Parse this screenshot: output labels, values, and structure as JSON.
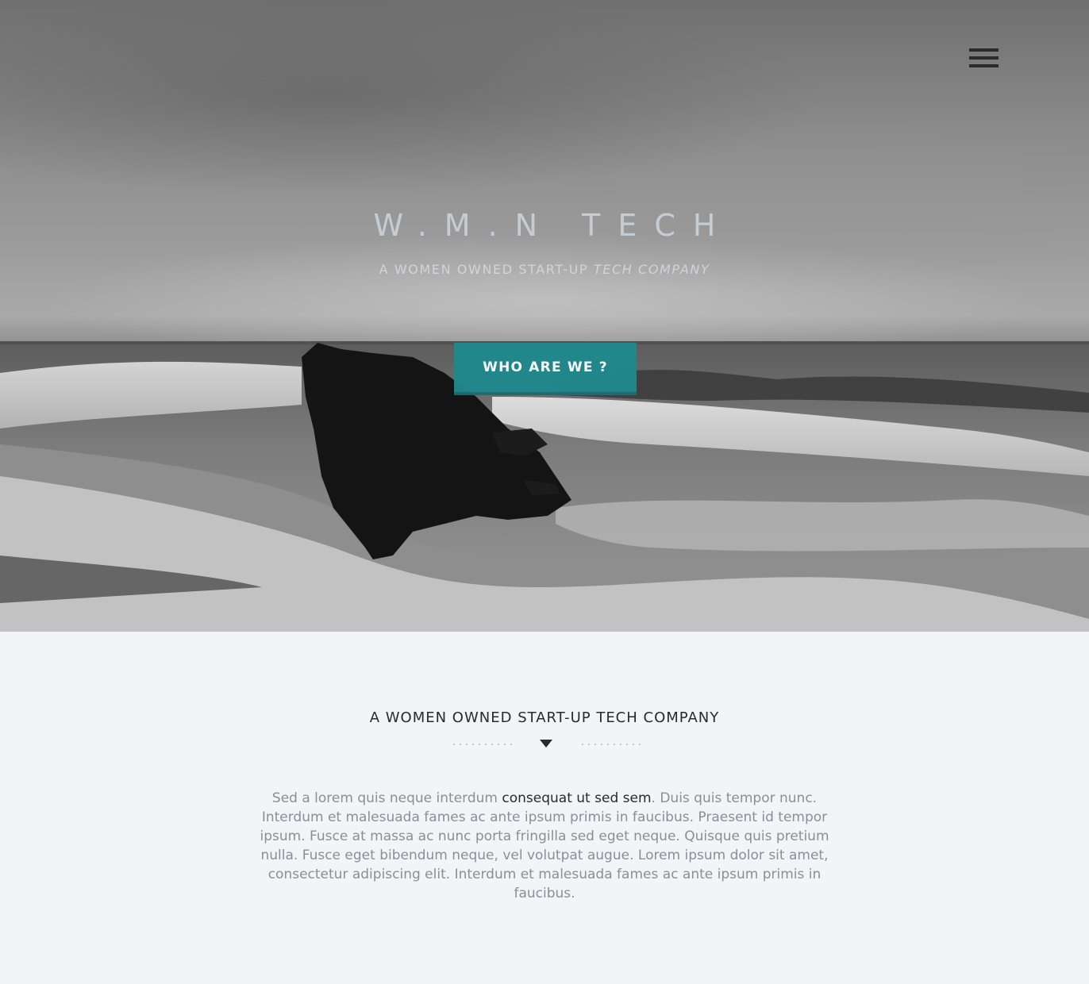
{
  "header": {
    "menu_icon": "hamburger-menu-icon"
  },
  "hero": {
    "title": "W.M.N TECH",
    "subtitle_plain": "A WOMEN OWNED START-UP ",
    "subtitle_em": "TECH COMPANY",
    "cta_label": "WHO ARE WE ?"
  },
  "about": {
    "heading": "A WOMEN OWNED START-UP TECH COMPANY",
    "text_before": "Sed a lorem quis neque interdum ",
    "text_highlight": "consequat ut sed sem",
    "text_after": ". Duis quis tempor nunc. Interdum et malesuada fames ac ante ipsum primis in faucibus. Praesent id tempor ipsum. Fusce at massa ac nunc porta fringilla sed eget neque. Quisque quis pretium nulla. Fusce eget bibendum neque, vel volutpat augue. Lorem ipsum dolor sit amet, consectetur adipiscing elit. Interdum et malesuada fames ac ante ipsum primis in faucibus.",
    "divider_icon": "triangle-down-icon"
  },
  "colors": {
    "accent": "#20898d",
    "heading": "#2a2a2a",
    "body_text": "#8a8e96",
    "section_bg": "#f3f4f7"
  }
}
